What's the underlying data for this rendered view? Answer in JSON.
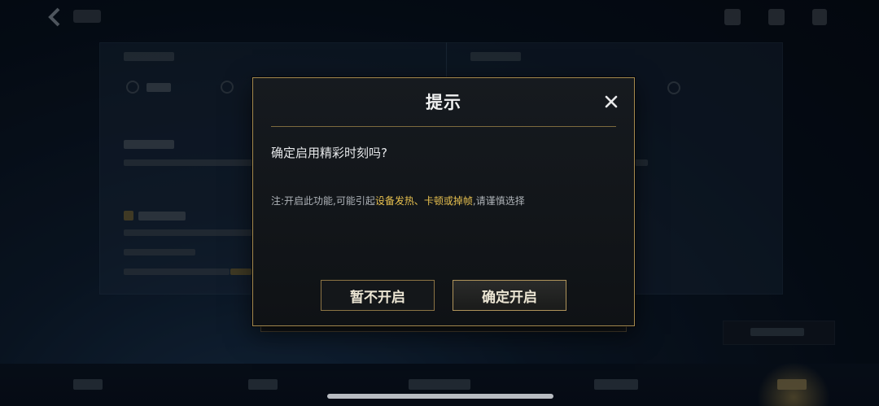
{
  "dialog": {
    "title": "提示",
    "question": "确定启用精彩时刻吗?",
    "note_prefix": "注:开启此功能,可能引起",
    "note_highlight_1": "设备发热",
    "note_sep": "、",
    "note_highlight_2": "卡顿或掉帧",
    "note_suffix": ",请谨慎选择",
    "cancel_label": "暂不开启",
    "confirm_label": "确定开启"
  },
  "colors": {
    "gold_border": "#a58a4f",
    "highlight": "#e7c04f",
    "dialog_bg": "#131619"
  },
  "icons": {
    "close": "close-icon",
    "back": "back-arrow-icon"
  }
}
